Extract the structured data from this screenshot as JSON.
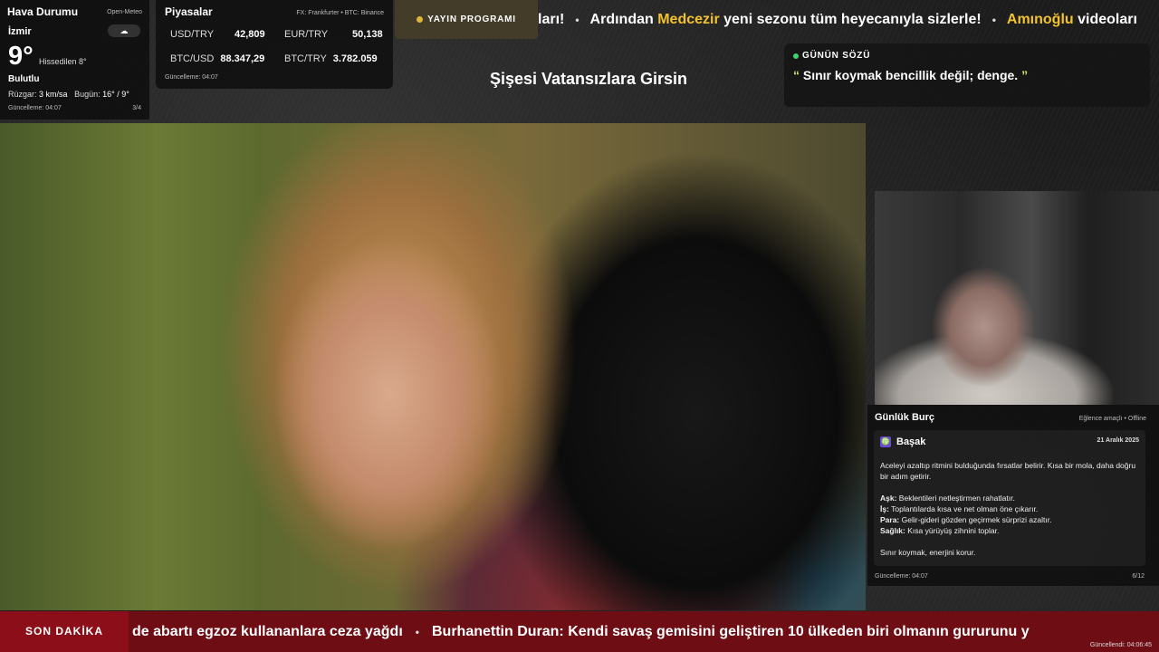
{
  "weather": {
    "title": "Hava Durumu",
    "source": "Open-Meteo",
    "city": "İzmir",
    "icon": "☁",
    "temperature": "9°",
    "feels_like": "Hissedilen 8°",
    "condition": "Bulutlu",
    "wind_label": "Rüzgar:",
    "wind_value": "3 km/sa",
    "today_label": "Bugün:",
    "today_value": "16° / 9°",
    "updated": "Güncelleme: 04:07",
    "page": "3/4"
  },
  "markets": {
    "title": "Piyasalar",
    "source": "FX: Frankfurter • BTC: Binance",
    "rows": [
      {
        "label": "USD/TRY",
        "value": "42,809"
      },
      {
        "label": "EUR/TRY",
        "value": "50,138"
      },
      {
        "label": "BTC/USD",
        "value": "88.347,29"
      },
      {
        "label": "BTC/TRY",
        "value": "3.782.059"
      }
    ],
    "updated": "Güncelleme: 04:07"
  },
  "schedule": {
    "label": "YAYIN PROGRAMI"
  },
  "top_ticker": {
    "part1": "ları!",
    "part2_pre": "Ardından ",
    "part2_highlight": "Medcezir",
    "part2_post": " yeni sezonu tüm heyecanıyla sizlerle!",
    "part3_highlight": "Amınoğlu",
    "part3_post": " videoları"
  },
  "show_title": "Şişesi Vatansızlara Girsin",
  "quote": {
    "label": "GÜNÜN SÖZÜ",
    "text": "Sınır koymak bencillik değil; denge."
  },
  "horoscope": {
    "title": "Günlük Burç",
    "meta": "Eğlence amaçlı • Offline",
    "sign_icon": "♍",
    "sign": "Başak",
    "date": "21 Aralık 2025",
    "intro": "Aceleyi azaltıp ritmini bulduğunda fırsatlar belirir. Kısa bir mola, daha doğru bir adım getirir.",
    "love_label": "Aşk:",
    "love": " Beklentileri netleştirmen rahatlatır.",
    "work_label": "İş:",
    "work": " Toplantılarda kısa ve net olman öne çıkarır.",
    "money_label": "Para:",
    "money": " Gelir-gideri gözden geçirmek sürprizi azaltır.",
    "health_label": "Sağlık:",
    "health": " Kısa yürüyüş zihnini toplar.",
    "closing": "Sınır koymak, enerjini korur.",
    "updated": "Güncelleme: 04:07",
    "page": "6/12"
  },
  "breaking": {
    "label": "SON DAKİKA",
    "item1": "de abartı egzoz kullananlara ceza yağdı",
    "item2": "Burhanettin Duran: Kendi savaş gemisini geliştiren 10 ülkeden biri olmanın gururunu y",
    "updated": "Güncellendi: 04:06:45"
  },
  "colors": {
    "highlight": "#f2c230",
    "breaking_bg": "#6e0d14",
    "quote_mark": "#c9e36a",
    "live_dot": "#3fd36c"
  }
}
